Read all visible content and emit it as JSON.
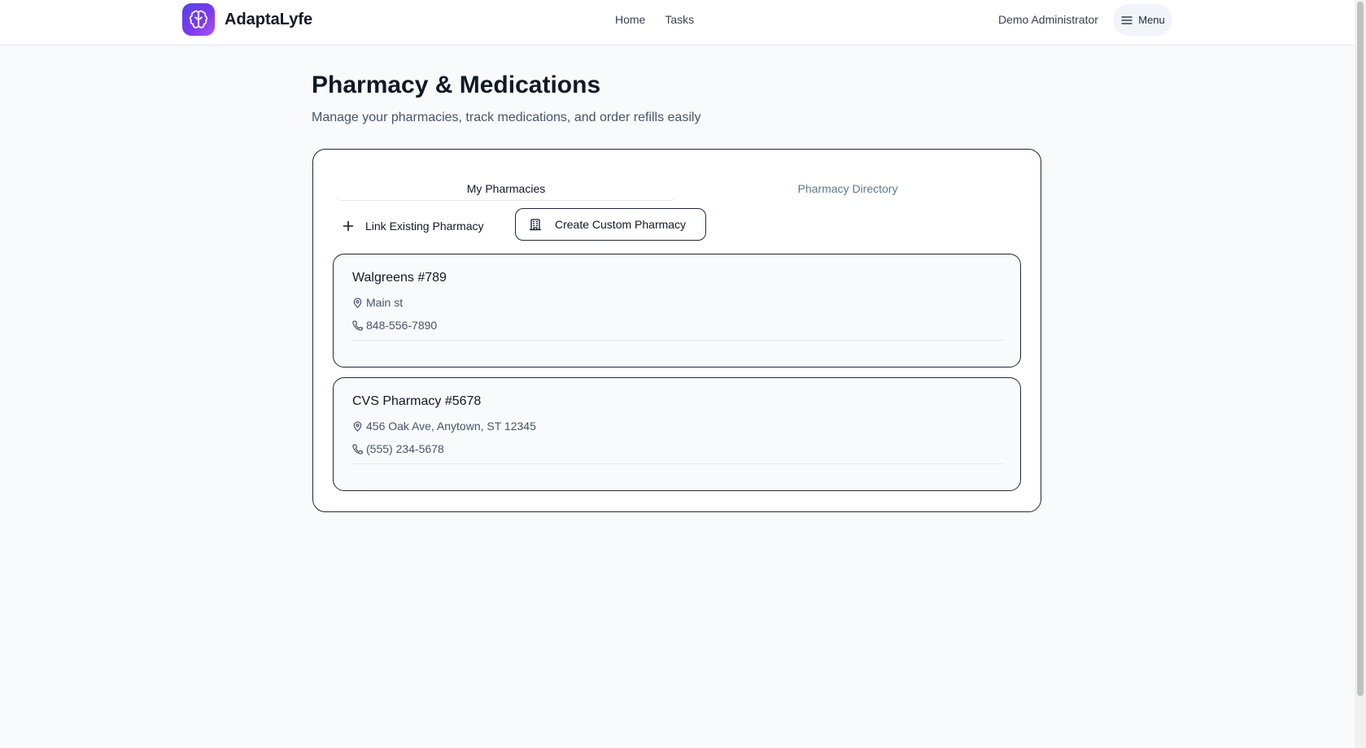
{
  "header": {
    "app_name": "AdaptaLyfe",
    "logo_icon": "brain-icon",
    "brand_colors": [
      "#4f46e5",
      "#a855f7"
    ],
    "nav": [
      {
        "label": "Home"
      },
      {
        "label": "Tasks"
      }
    ],
    "user_name": "Demo Administrator",
    "menu_label": "Menu"
  },
  "page": {
    "title": "Pharmacy & Medications",
    "subtitle": "Manage your pharmacies, track medications, and order refills easily"
  },
  "tabs": [
    {
      "label": "My Pharmacies",
      "active": true
    },
    {
      "label": "Pharmacy Directory",
      "active": false
    }
  ],
  "actions": {
    "link_label": "Link Existing Pharmacy",
    "link_icon": "plus-icon",
    "create_label": "Create Custom Pharmacy",
    "create_icon": "building-icon"
  },
  "pharmacies": [
    {
      "name": "Walgreens #789",
      "address": "Main st",
      "phone": "848-556-7890"
    },
    {
      "name": "CVS Pharmacy #5678",
      "address": "456 Oak Ave, Anytown, ST 12345",
      "phone": "(555) 234-5678"
    }
  ]
}
